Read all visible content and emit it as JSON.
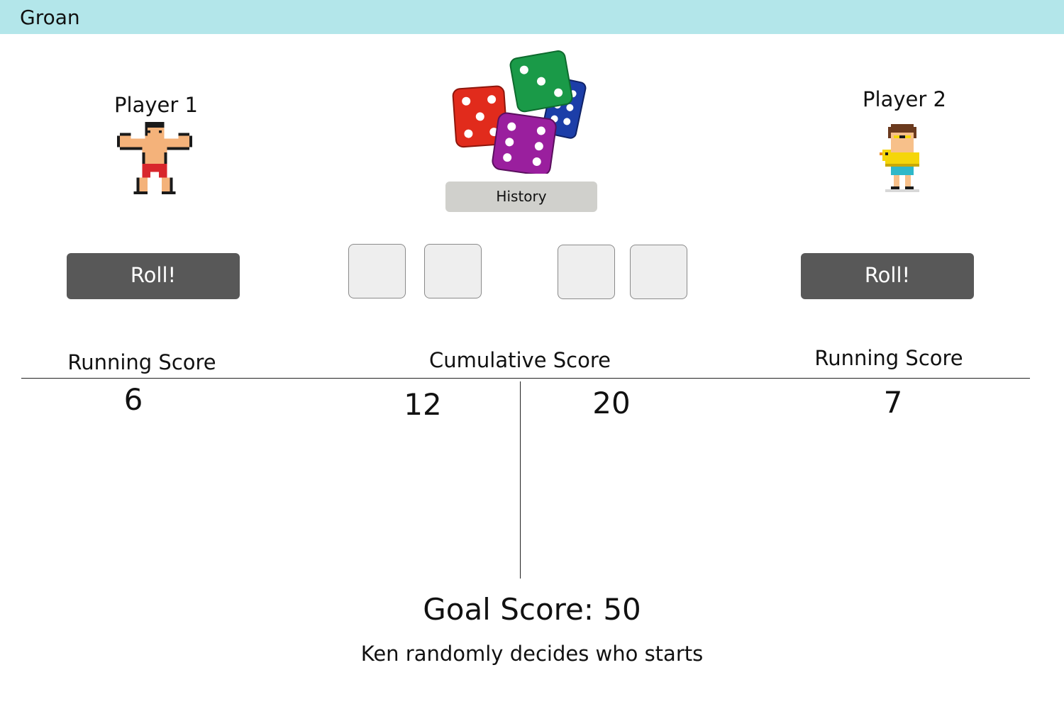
{
  "app": {
    "title": "Groan"
  },
  "players": [
    {
      "name": "Player 1",
      "avatar_icon": "muscle-man-pixel-icon",
      "roll_label": "Roll!",
      "running_score_label": "Running Score",
      "running_score": "6",
      "cumulative_score": "12",
      "dice": [
        "",
        ""
      ]
    },
    {
      "name": "Player 2",
      "avatar_icon": "swimmer-duck-float-pixel-icon",
      "roll_label": "Roll!",
      "running_score_label": "Running Score",
      "running_score": "7",
      "cumulative_score": "20",
      "dice": [
        "",
        ""
      ]
    }
  ],
  "center": {
    "logo_icon": "dice-pile-icon",
    "history_label": "History",
    "cumulative_score_label": "Cumulative Score"
  },
  "goal": {
    "text": "Goal Score: 50"
  },
  "status": {
    "text": "Ken randomly decides who starts"
  },
  "colors": {
    "titlebar": "#b3e6ea",
    "roll_button": "#585858",
    "history_button": "#d0d0cc",
    "die_slot": "#eeeeee"
  }
}
